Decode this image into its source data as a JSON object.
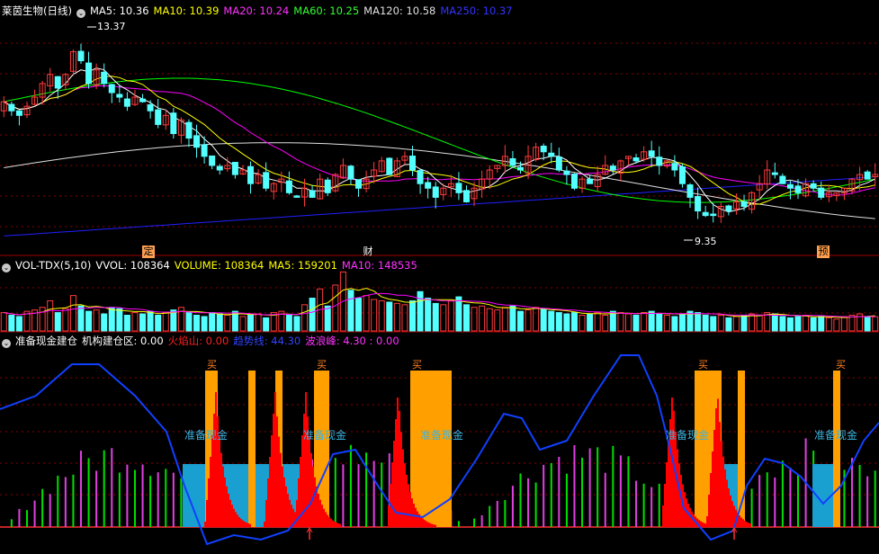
{
  "colors": {
    "bg": "#000000",
    "up": "#ff3b3b",
    "down": "#54ffff",
    "grid": "#8b0000",
    "ma5": "#ffffff",
    "ma10": "#ffff00",
    "ma20": "#ff00ff",
    "ma60": "#00ff00",
    "ma120": "#e0e0e0",
    "ma250": "#2020ff",
    "green": "#00e000",
    "violet": "#e040e0",
    "orange": "#ffa000",
    "red": "#ff0000",
    "blue": "#1040ff",
    "teal": "#1aa0d0"
  },
  "header1": {
    "title": "莱茵生物(日线)",
    "ma5": "MA5: 10.36",
    "ma10": "MA10: 10.39",
    "ma20": "MA20: 10.24",
    "ma60": "MA60: 10.25",
    "ma120": "MA120: 10.58",
    "ma250": "MA250: 10.37",
    "icon": "chevron-down-icon"
  },
  "header2": {
    "title": "VOL-TDX(5,10)",
    "vvol": "VVOL: 108364",
    "volume": "VOLUME: 108364",
    "ma5": "MA5: 159201",
    "ma10": "MA10: 148535"
  },
  "header3": {
    "title": "准备现金建仓",
    "jgjcq": "机构建仓区: 0.00",
    "hys": "火焰山: 0.00",
    "qsx": "趋势线: 44.30",
    "blf": "波浪峰: 4.30 : 0.00"
  },
  "markers": {
    "ding": "定",
    "cai": "财",
    "yu": "预",
    "high": "13.37",
    "low": "9.35",
    "buy": "买",
    "cash": "准备现金"
  },
  "chart_data": [
    {
      "type": "candlestick",
      "title": "莱茵生物(日线)",
      "ylim": [
        8.9,
        13.8
      ],
      "high_label": 13.37,
      "low_label": 9.35,
      "series": [
        {
          "name": "MA5",
          "value": 10.36
        },
        {
          "name": "MA10",
          "value": 10.39
        },
        {
          "name": "MA20",
          "value": 10.24
        },
        {
          "name": "MA60",
          "value": 10.25
        },
        {
          "name": "MA120",
          "value": 10.58
        },
        {
          "name": "MA250",
          "value": 10.37
        }
      ],
      "close": [
        12.0,
        11.8,
        11.7,
        11.9,
        12.1,
        12.4,
        12.6,
        12.3,
        12.6,
        13.1,
        12.9,
        12.4,
        12.7,
        12.4,
        12.2,
        12.1,
        11.9,
        12.1,
        12.0,
        11.8,
        11.5,
        11.7,
        11.3,
        11.6,
        11.2,
        11.0,
        10.8,
        10.6,
        10.5,
        10.6,
        10.4,
        10.5,
        10.2,
        10.4,
        10.1,
        10.2,
        10.3,
        10.0,
        9.9,
        10.1,
        9.9,
        10.3,
        10.0,
        10.4,
        10.6,
        10.3,
        10.1,
        10.3,
        10.5,
        10.7,
        10.4,
        10.7,
        10.8,
        10.5,
        10.2,
        10.1,
        9.9,
        10.1,
        10.2,
        10.0,
        9.8,
        10.1,
        10.3,
        10.5,
        10.6,
        10.8,
        10.6,
        10.5,
        10.8,
        11.0,
        10.9,
        10.8,
        10.5,
        10.4,
        10.1,
        10.3,
        10.2,
        10.4,
        10.6,
        10.5,
        10.7,
        10.8,
        10.7,
        10.9,
        10.8,
        10.6,
        10.7,
        10.5,
        10.2,
        9.9,
        9.6,
        9.5,
        9.5,
        9.7,
        9.6,
        9.8,
        9.7,
        10.0,
        10.2,
        10.5,
        10.4,
        10.2,
        10.1,
        10.0,
        10.2,
        10.1,
        9.9,
        10.0,
        10.0,
        10.1,
        10.3,
        10.4,
        10.3,
        10.4
      ],
      "volume": [
        140000,
        120000,
        110000,
        150000,
        160000,
        180000,
        230000,
        140000,
        170000,
        270000,
        190000,
        150000,
        160000,
        130000,
        180000,
        170000,
        120000,
        140000,
        130000,
        150000,
        120000,
        140000,
        160000,
        180000,
        140000,
        120000,
        110000,
        140000,
        130000,
        120000,
        150000,
        110000,
        120000,
        130000,
        100000,
        140000,
        150000,
        120000,
        110000,
        200000,
        250000,
        320000,
        190000,
        350000,
        450000,
        310000,
        250000,
        270000,
        240000,
        230000,
        220000,
        210000,
        200000,
        230000,
        300000,
        250000,
        210000,
        200000,
        230000,
        260000,
        200000,
        180000,
        190000,
        170000,
        160000,
        180000,
        190000,
        150000,
        160000,
        180000,
        170000,
        150000,
        140000,
        130000,
        140000,
        120000,
        130000,
        140000,
        120000,
        150000,
        140000,
        130000,
        120000,
        140000,
        150000,
        130000,
        120000,
        110000,
        130000,
        150000,
        140000,
        120000,
        110000,
        120000,
        100000,
        110000,
        120000,
        130000,
        120000,
        140000,
        130000,
        110000,
        100000,
        110000,
        120000,
        100000,
        110000,
        100000,
        90000,
        110000,
        120000,
        130000,
        110000,
        108364
      ]
    },
    {
      "type": "bar",
      "title": "VOL-TDX(5,10)",
      "values_ref": "volume",
      "series": [
        {
          "name": "VVOL",
          "value": 108364
        },
        {
          "name": "VOLUME",
          "value": 108364
        },
        {
          "name": "MA5",
          "value": 159201
        },
        {
          "name": "MA10",
          "value": 148535
        }
      ]
    },
    {
      "type": "bar",
      "title": "准备现金建仓",
      "series": [
        {
          "name": "机构建仓区",
          "value": 0.0
        },
        {
          "name": "火焰山",
          "value": 0.0
        },
        {
          "name": "趋势线",
          "value": 44.3
        },
        {
          "name": "波浪峰",
          "value": 4.3
        }
      ]
    }
  ]
}
